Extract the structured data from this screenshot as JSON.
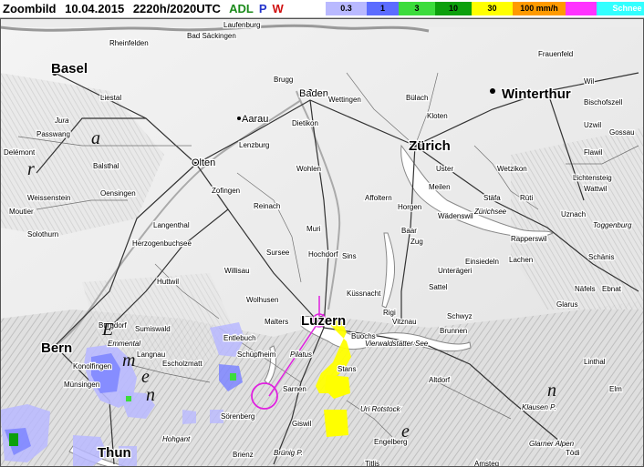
{
  "header": {
    "title": "Zoombild",
    "date": "10.04.2015",
    "time": "2220h/2020UTC",
    "logo": {
      "a": "ADL",
      "p": "P",
      "w": "W",
      "color_adl": "#1a8a1a",
      "color_p": "#2233cc",
      "color_w": "#d01010"
    }
  },
  "legend": [
    {
      "label": "0.3",
      "color": "#b9b9ff"
    },
    {
      "label": "1",
      "color": "#5c6cff"
    },
    {
      "label": "3",
      "color": "#3cdc3c"
    },
    {
      "label": "10",
      "color": "#0ca00c"
    },
    {
      "label": "30",
      "color": "#ffff00"
    },
    {
      "label": "100 mm/h",
      "color": "#ff9a00"
    },
    {
      "label": "",
      "color": "#ff33ff"
    },
    {
      "label": "Schnee",
      "color": "#33ffff"
    }
  ],
  "map": {
    "cities": [
      "Basel",
      "Zürich",
      "Winterthur",
      "Bern",
      "Luzern",
      "Thun",
      "Aarau",
      "Olten",
      "Baden"
    ],
    "towns": [
      "Rheinfelden",
      "Bad Säckingen",
      "Laufenburg",
      "Liestal",
      "Brugg",
      "Wettingen",
      "Bülach",
      "Kloten",
      "Frauenfeld",
      "Wil",
      "Dietikon",
      "Lenzburg",
      "Wohlen",
      "Zofingen",
      "Langenthal",
      "Solothurn",
      "Delémont",
      "Moutier",
      "Burgdorf",
      "Sursee",
      "Willisau",
      "Wolhusen",
      "Malters",
      "Entlebuch",
      "Schüpfheim",
      "Sarnen",
      "Stans",
      "Schwyz",
      "Zug",
      "Baar",
      "Horgen",
      "Wädenswil",
      "Rapperswil",
      "Uster",
      "Meilen",
      "Stäfa",
      "Rüti",
      "Wetzikon",
      "Küssnacht",
      "Rigi",
      "Brunnen",
      "Altdorf",
      "Glarus",
      "Engelberg",
      "Giswil",
      "Brienz",
      "Sörenberg",
      "Münsingen",
      "Konolfingen",
      "Langnau",
      "Escholzmatt",
      "Huttwil",
      "Sumiswald",
      "Weissenstein",
      "Passwang",
      "Balsthal",
      "Oensingen",
      "Herzogenbuchsee",
      "Lachen",
      "Einsiedeln",
      "Unterägeri",
      "Sattel",
      "Vitznau",
      "Buochs",
      "Hochdorf",
      "Muri",
      "Reinach",
      "Affoltern",
      "Sins",
      "Gossau",
      "Bischofszell",
      "Uzwil",
      "Flawil",
      "Lichtensteig",
      "Wattwil",
      "Uznach",
      "Schänis",
      "Näfels",
      "Ebnat",
      "Linthal",
      "Tödi",
      "Titlis",
      "Amsteg",
      "Elm"
    ],
    "regions": [
      "Jura",
      "Emmental",
      "Toggenburg",
      "Glarner Alpen"
    ],
    "lakes": [
      "Vierwaldstätter See",
      "Zürichsee"
    ],
    "passes": [
      "Klausen P.",
      "Brünig P."
    ],
    "peaks": [
      "Pilatus",
      "Uri Rotstock",
      "Hohgant"
    ],
    "colors": {
      "rain_light": "#b9b9ff",
      "rain_mid": "#5c6cff",
      "rain_green": "#3cdc3c",
      "rain_yellow": "#ffff00",
      "marker": "#e020e0"
    }
  }
}
